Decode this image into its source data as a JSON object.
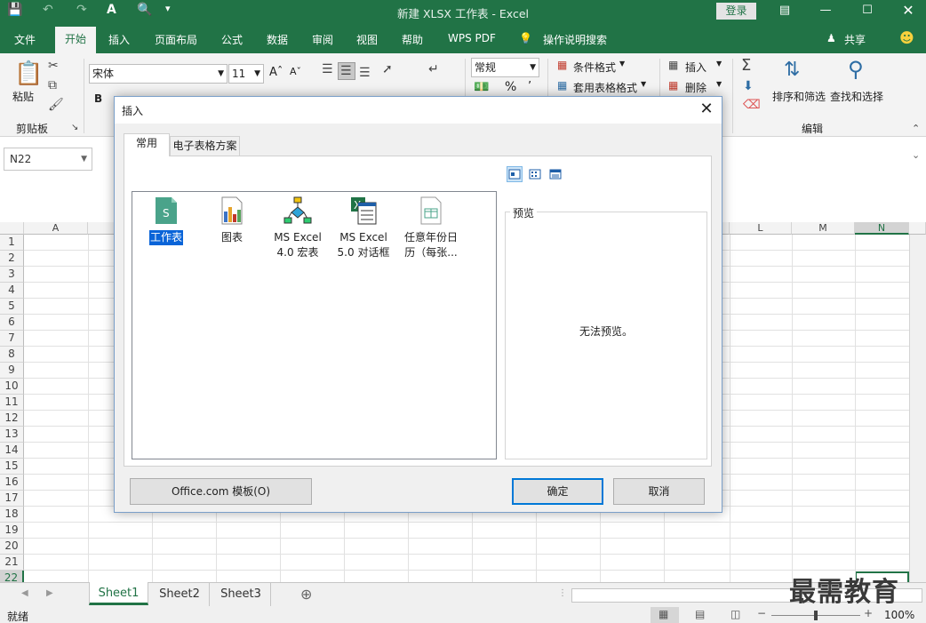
{
  "titlebar": {
    "title": "新建 XLSX 工作表 - Excel",
    "login": "登录"
  },
  "tabs": [
    "文件",
    "开始",
    "插入",
    "页面布局",
    "公式",
    "数据",
    "审阅",
    "视图",
    "帮助",
    "WPS PDF",
    "操作说明搜索"
  ],
  "share": "共享",
  "ribbon": {
    "paste": "粘贴",
    "clipboard": "剪贴板",
    "font_name": "宋体",
    "font_size": "11",
    "bold": "B",
    "number_format": "常规",
    "percent": "%",
    "cond_format": "条件格式",
    "table_format": "套用表格格式",
    "insert": "插入",
    "delete": "删除",
    "sort_filter": "排序和筛选",
    "find_select": "查找和选择",
    "editing": "编辑"
  },
  "namebox": "N22",
  "columns": [
    "A",
    "L",
    "M",
    "N"
  ],
  "rows": [
    "1",
    "2",
    "3",
    "4",
    "5",
    "6",
    "7",
    "8",
    "9",
    "10",
    "11",
    "12",
    "13",
    "14",
    "15",
    "16",
    "17",
    "18",
    "19",
    "20",
    "21",
    "22"
  ],
  "sheets": [
    "Sheet1",
    "Sheet2",
    "Sheet3"
  ],
  "status": {
    "ready": "就绪",
    "zoom": "100%"
  },
  "watermark": "最需教育",
  "dialog": {
    "title": "插入",
    "tabs": [
      "常用",
      "电子表格方案"
    ],
    "items": [
      {
        "line1": "工作表",
        "line2": ""
      },
      {
        "line1": "图表",
        "line2": ""
      },
      {
        "line1": "MS Excel",
        "line2": "4.0 宏表"
      },
      {
        "line1": "MS Excel",
        "line2": "5.0 对话框"
      },
      {
        "line1": "任意年份日",
        "line2": "历（每张..."
      }
    ],
    "preview_label": "预览",
    "preview_text": "无法预览。",
    "office_button": "Office.com 模板(O)",
    "ok": "确定",
    "cancel": "取消"
  },
  "colors": {
    "accent": "#217346",
    "selection": "#0a64d8"
  }
}
